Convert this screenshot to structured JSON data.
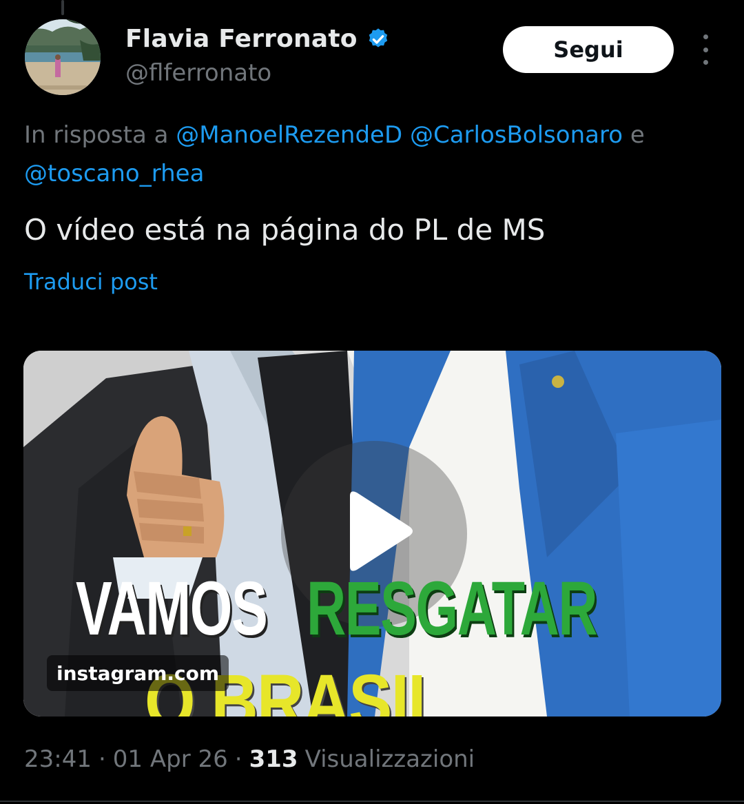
{
  "post": {
    "author": {
      "display_name": "Flavia Ferronato",
      "handle": "@flferronato",
      "verified_icon": "verified-badge-icon",
      "avatar_icon": "avatar-beach-photo"
    },
    "follow_label": "Segui",
    "more_icon": "more-vertical-icon",
    "reply_context": {
      "prefix": "In risposta a",
      "mentions": [
        "@ManoelRezendeD",
        "@CarlosBolsonaro",
        "@toscano_rhea"
      ],
      "conjunction": "e"
    },
    "text": "O vídeo está na página do PL de MS",
    "translate_label": "Traduci post",
    "media": {
      "type": "video",
      "play_icon": "play-icon",
      "overlay_lines": {
        "white": "VAMOS",
        "green": "RESGATAR",
        "yellow": "O BRASIL"
      },
      "source_label": "instagram.com"
    },
    "meta": {
      "time": "23:41",
      "date": "01 Apr 26",
      "separator": "·",
      "views_count": "313",
      "views_label": "Visualizzazioni"
    }
  },
  "colors": {
    "background": "#000000",
    "text_primary": "#e7e9ea",
    "text_secondary": "#71767b",
    "accent": "#1d9bf0"
  }
}
